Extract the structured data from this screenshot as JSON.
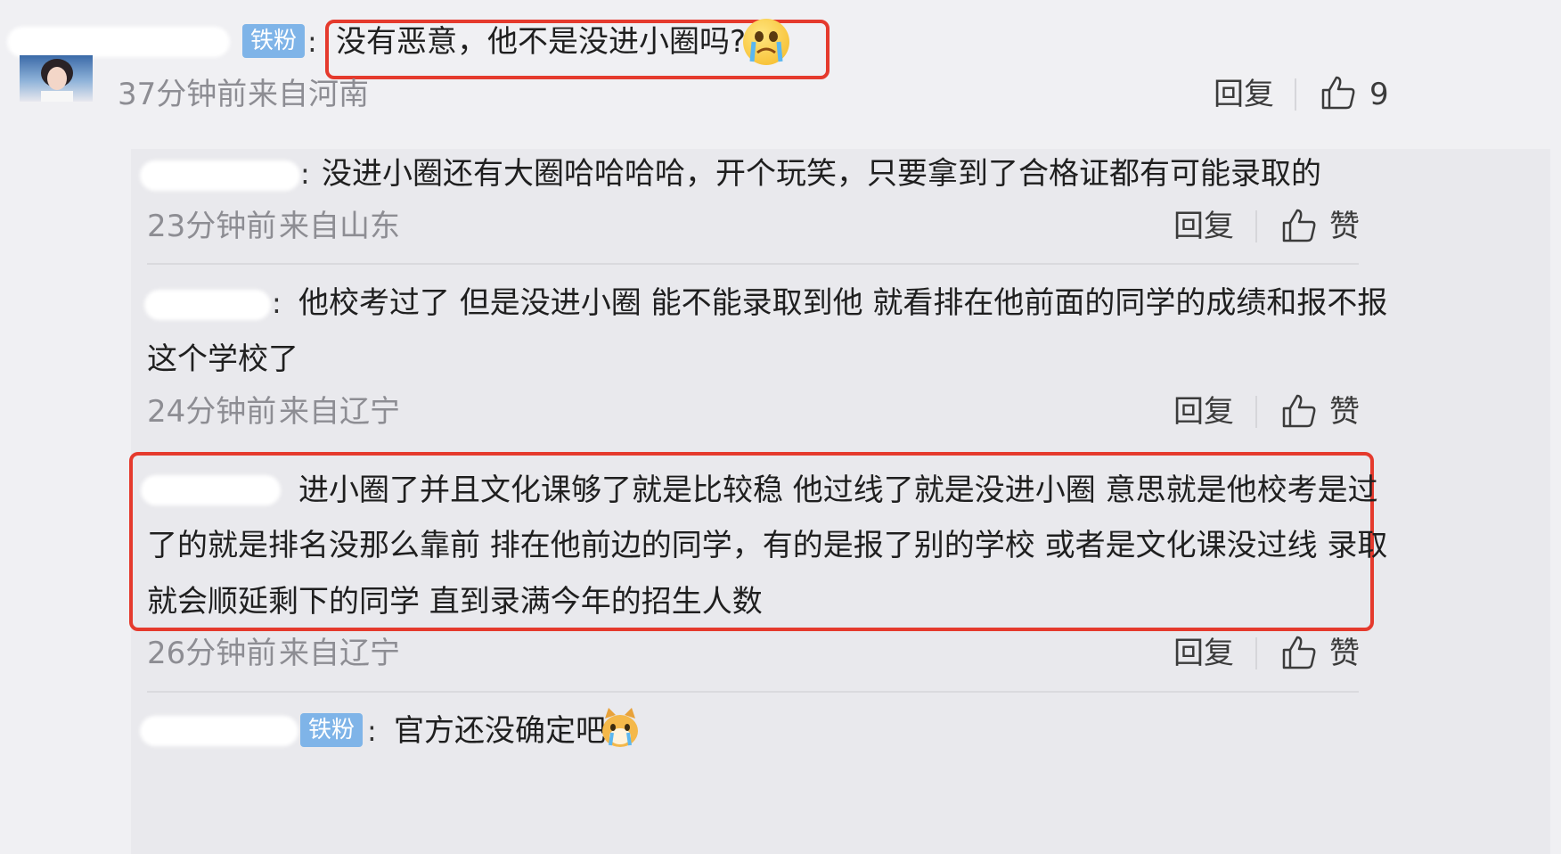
{
  "top_comment": {
    "badge": "铁粉",
    "colon": ":",
    "text": "没有恶意，他不是没进小圈吗?",
    "emoji": "crying-face-icon",
    "time": "37分钟前",
    "location": "来自河南",
    "reply_label": "回复",
    "like_count": "9"
  },
  "replies": [
    {
      "colon": ":",
      "text_lines": [
        "没进小圈还有大圈哈哈哈哈，开个玩笑，只要拿到了合格证都有可能录取的"
      ],
      "time": "23分钟前",
      "location": "来自山东",
      "reply_label": "回复",
      "like_label": "赞"
    },
    {
      "colon": ":",
      "text_lines": [
        "他校考过了 但是没进小圈 能不能录取到他 就看排在他前面的同学的成绩和报不报",
        "这个学校了"
      ],
      "time": "24分钟前",
      "location": "来自辽宁",
      "reply_label": "回复",
      "like_label": "赞"
    },
    {
      "text_lines": [
        "进小圈了并且文化课够了就是比较稳 他过线了就是没进小圈 意思就是他校考是过",
        "了的就是排名没那么靠前 排在他前边的同学，有的是报了别的学校 或者是文化课没过线 录取",
        "就会顺延剩下的同学 直到录满今年的招生人数"
      ],
      "time": "26分钟前",
      "location": "来自辽宁",
      "reply_label": "回复",
      "like_label": "赞"
    },
    {
      "badge": "铁粉",
      "colon": ":",
      "text_lines": [
        "官方还没确定吧"
      ],
      "emoji": "crying-cat-icon"
    }
  ],
  "colors": {
    "highlight": "#e53a2d",
    "badge": "#7fb4e8",
    "meta_text": "#8d8d93",
    "panel_bg": "#e9e9ed"
  }
}
